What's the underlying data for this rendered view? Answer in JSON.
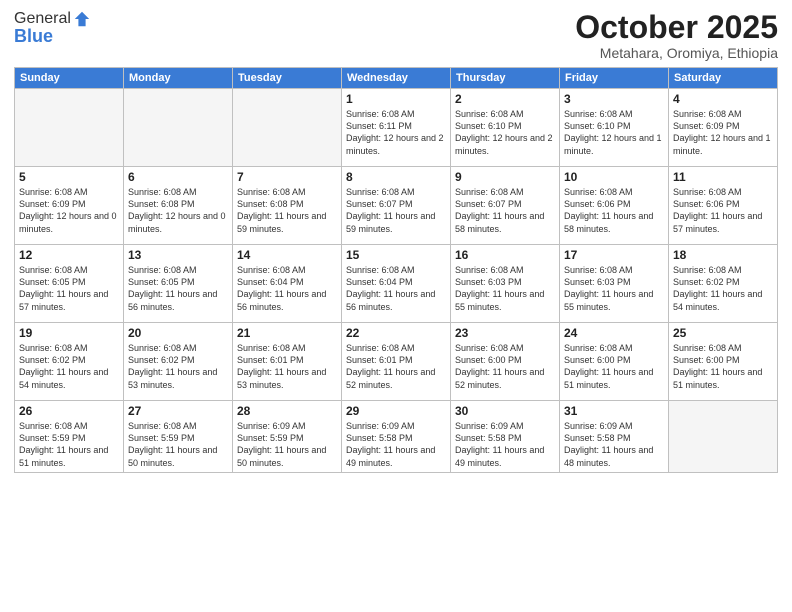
{
  "header": {
    "logo_line1": "General",
    "logo_line2": "Blue",
    "month": "October 2025",
    "location": "Metahara, Oromiya, Ethiopia"
  },
  "days_of_week": [
    "Sunday",
    "Monday",
    "Tuesday",
    "Wednesday",
    "Thursday",
    "Friday",
    "Saturday"
  ],
  "weeks": [
    [
      {
        "num": "",
        "info": ""
      },
      {
        "num": "",
        "info": ""
      },
      {
        "num": "",
        "info": ""
      },
      {
        "num": "1",
        "info": "Sunrise: 6:08 AM\nSunset: 6:11 PM\nDaylight: 12 hours and 2 minutes."
      },
      {
        "num": "2",
        "info": "Sunrise: 6:08 AM\nSunset: 6:10 PM\nDaylight: 12 hours and 2 minutes."
      },
      {
        "num": "3",
        "info": "Sunrise: 6:08 AM\nSunset: 6:10 PM\nDaylight: 12 hours and 1 minute."
      },
      {
        "num": "4",
        "info": "Sunrise: 6:08 AM\nSunset: 6:09 PM\nDaylight: 12 hours and 1 minute."
      }
    ],
    [
      {
        "num": "5",
        "info": "Sunrise: 6:08 AM\nSunset: 6:09 PM\nDaylight: 12 hours and 0 minutes."
      },
      {
        "num": "6",
        "info": "Sunrise: 6:08 AM\nSunset: 6:08 PM\nDaylight: 12 hours and 0 minutes."
      },
      {
        "num": "7",
        "info": "Sunrise: 6:08 AM\nSunset: 6:08 PM\nDaylight: 11 hours and 59 minutes."
      },
      {
        "num": "8",
        "info": "Sunrise: 6:08 AM\nSunset: 6:07 PM\nDaylight: 11 hours and 59 minutes."
      },
      {
        "num": "9",
        "info": "Sunrise: 6:08 AM\nSunset: 6:07 PM\nDaylight: 11 hours and 58 minutes."
      },
      {
        "num": "10",
        "info": "Sunrise: 6:08 AM\nSunset: 6:06 PM\nDaylight: 11 hours and 58 minutes."
      },
      {
        "num": "11",
        "info": "Sunrise: 6:08 AM\nSunset: 6:06 PM\nDaylight: 11 hours and 57 minutes."
      }
    ],
    [
      {
        "num": "12",
        "info": "Sunrise: 6:08 AM\nSunset: 6:05 PM\nDaylight: 11 hours and 57 minutes."
      },
      {
        "num": "13",
        "info": "Sunrise: 6:08 AM\nSunset: 6:05 PM\nDaylight: 11 hours and 56 minutes."
      },
      {
        "num": "14",
        "info": "Sunrise: 6:08 AM\nSunset: 6:04 PM\nDaylight: 11 hours and 56 minutes."
      },
      {
        "num": "15",
        "info": "Sunrise: 6:08 AM\nSunset: 6:04 PM\nDaylight: 11 hours and 56 minutes."
      },
      {
        "num": "16",
        "info": "Sunrise: 6:08 AM\nSunset: 6:03 PM\nDaylight: 11 hours and 55 minutes."
      },
      {
        "num": "17",
        "info": "Sunrise: 6:08 AM\nSunset: 6:03 PM\nDaylight: 11 hours and 55 minutes."
      },
      {
        "num": "18",
        "info": "Sunrise: 6:08 AM\nSunset: 6:02 PM\nDaylight: 11 hours and 54 minutes."
      }
    ],
    [
      {
        "num": "19",
        "info": "Sunrise: 6:08 AM\nSunset: 6:02 PM\nDaylight: 11 hours and 54 minutes."
      },
      {
        "num": "20",
        "info": "Sunrise: 6:08 AM\nSunset: 6:02 PM\nDaylight: 11 hours and 53 minutes."
      },
      {
        "num": "21",
        "info": "Sunrise: 6:08 AM\nSunset: 6:01 PM\nDaylight: 11 hours and 53 minutes."
      },
      {
        "num": "22",
        "info": "Sunrise: 6:08 AM\nSunset: 6:01 PM\nDaylight: 11 hours and 52 minutes."
      },
      {
        "num": "23",
        "info": "Sunrise: 6:08 AM\nSunset: 6:00 PM\nDaylight: 11 hours and 52 minutes."
      },
      {
        "num": "24",
        "info": "Sunrise: 6:08 AM\nSunset: 6:00 PM\nDaylight: 11 hours and 51 minutes."
      },
      {
        "num": "25",
        "info": "Sunrise: 6:08 AM\nSunset: 6:00 PM\nDaylight: 11 hours and 51 minutes."
      }
    ],
    [
      {
        "num": "26",
        "info": "Sunrise: 6:08 AM\nSunset: 5:59 PM\nDaylight: 11 hours and 51 minutes."
      },
      {
        "num": "27",
        "info": "Sunrise: 6:08 AM\nSunset: 5:59 PM\nDaylight: 11 hours and 50 minutes."
      },
      {
        "num": "28",
        "info": "Sunrise: 6:09 AM\nSunset: 5:59 PM\nDaylight: 11 hours and 50 minutes."
      },
      {
        "num": "29",
        "info": "Sunrise: 6:09 AM\nSunset: 5:58 PM\nDaylight: 11 hours and 49 minutes."
      },
      {
        "num": "30",
        "info": "Sunrise: 6:09 AM\nSunset: 5:58 PM\nDaylight: 11 hours and 49 minutes."
      },
      {
        "num": "31",
        "info": "Sunrise: 6:09 AM\nSunset: 5:58 PM\nDaylight: 11 hours and 48 minutes."
      },
      {
        "num": "",
        "info": ""
      }
    ]
  ]
}
